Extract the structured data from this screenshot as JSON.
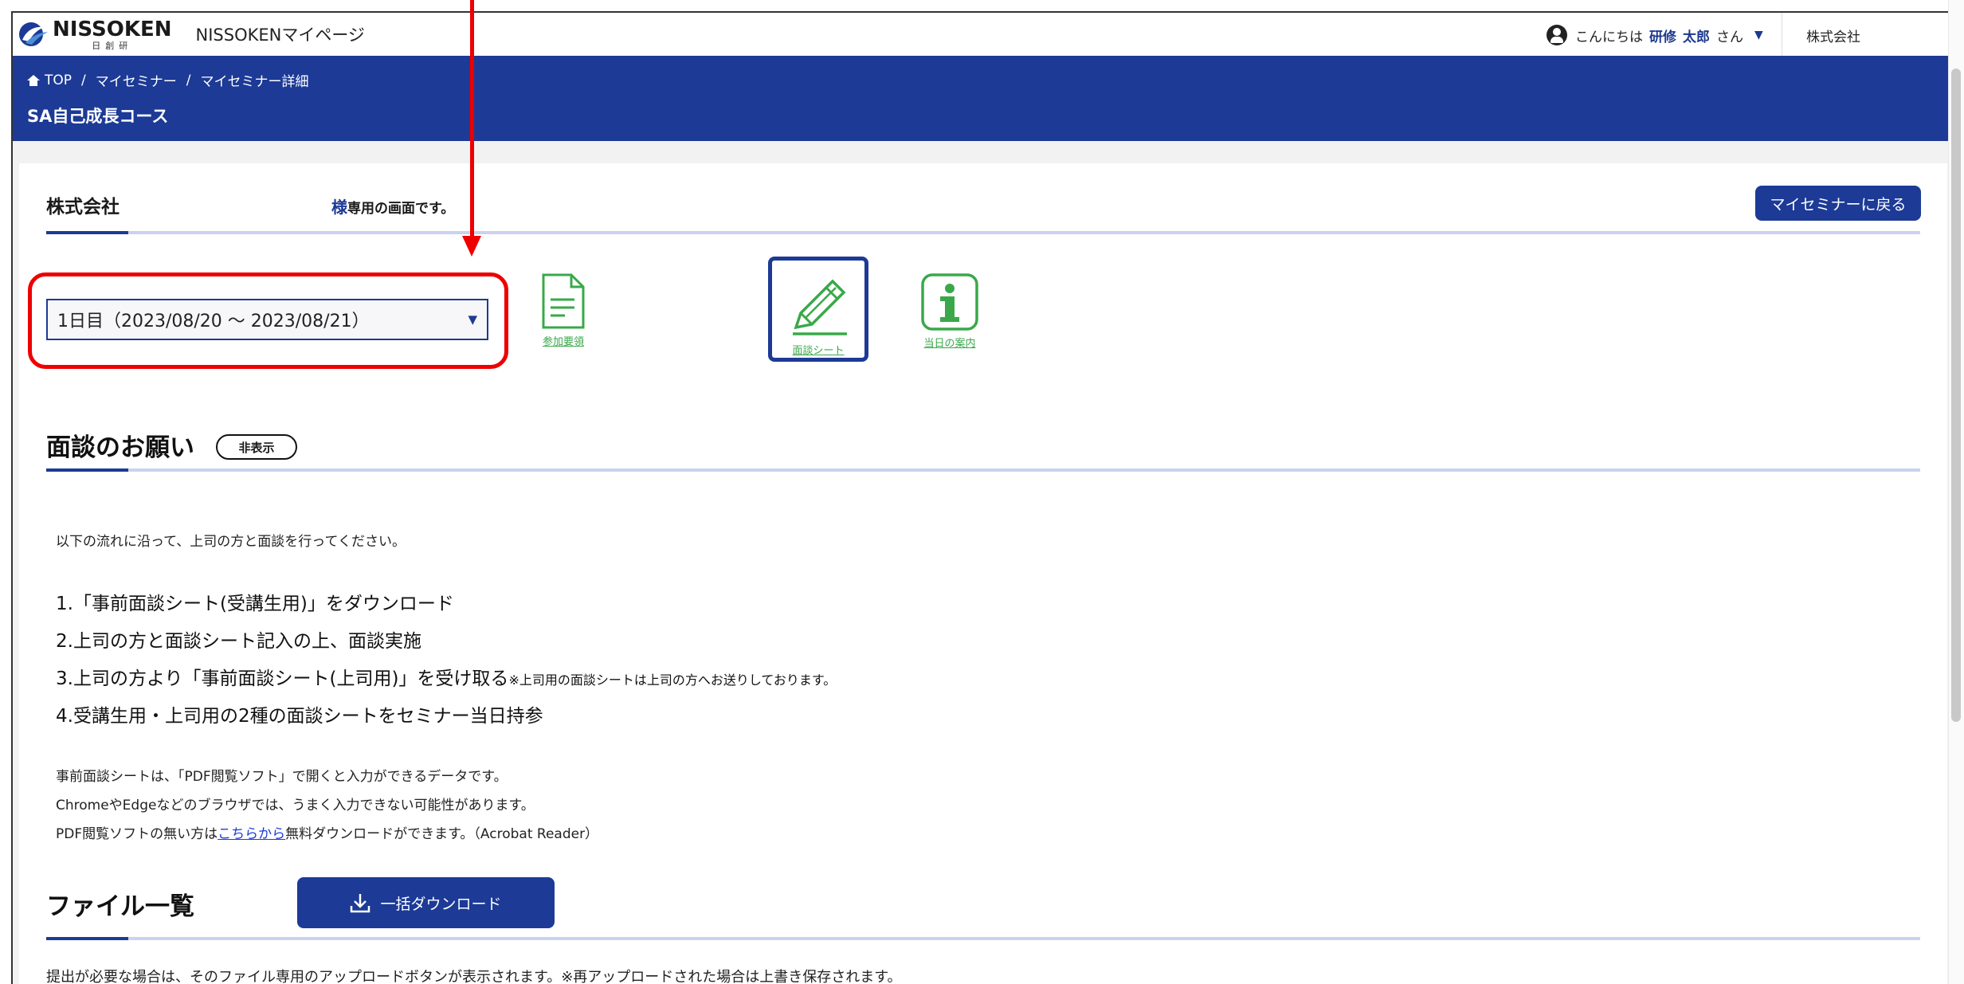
{
  "header": {
    "logo_text": "NISSOKEN",
    "logo_subtext": "日創研",
    "app_title": "NISSOKENマイページ",
    "greeting": "こんにちは",
    "user_last_name": "研修",
    "user_first_name": "太郎",
    "honorific": "さん",
    "company_short": "株式会社"
  },
  "breadcrumb": {
    "items": [
      "TOP",
      "マイセミナー",
      "マイセミナー詳細"
    ],
    "separator": "/"
  },
  "page_title": "SA自己成長コース",
  "company_section": {
    "company": "株式会社",
    "sama": "様",
    "dedicated_text": "専用の画面です。",
    "back_button": "マイセミナーに戻る"
  },
  "day_select": {
    "selected": "1日目（2023/08/20 〜 2023/08/21）"
  },
  "tiles": {
    "doc_label": "参加要領",
    "sheet_label": "面談シート",
    "info_label": "当日の案内"
  },
  "interview_section": {
    "heading": "面談のお願い",
    "hide_button": "非表示",
    "intro": "以下の流れに沿って、上司の方と面談を行ってください。",
    "step1": "1.「事前面談シート(受講生用)」をダウンロード",
    "step2": "2.上司の方と面談シート記入の上、面談実施",
    "step3": "3.上司の方より「事前面談シート(上司用)」を受け取る",
    "step3_note": "※上司用の面談シートは上司の方へお送りしております。",
    "step4": "4.受講生用・上司用の2種の面談シートをセミナー当日持参",
    "note1": "事前面談シートは、「PDF閲覧ソフト」で開くと入力ができるデータです。",
    "note2": "ChromeやEdgeなどのブラウザでは、うまく入力できない可能性があります。",
    "note3_pre": "PDF閲覧ソフトの無い方は",
    "note3_link": "こちらから",
    "note3_post": "無料ダウンロードができます。（Acrobat Reader）"
  },
  "files_section": {
    "heading": "ファイル一覧",
    "download_all_button": "一括ダウンロード",
    "notice": "提出が必要な場合は、そのファイル専用のアップロードボタンが表示されます。※再アップロードされた場合は上書き保存されます。"
  },
  "colors": {
    "brand_blue": "#1c3a96",
    "accent_red": "#ee0000",
    "icon_green": "#3aa84a",
    "rule_light": "#c9d3ef"
  }
}
